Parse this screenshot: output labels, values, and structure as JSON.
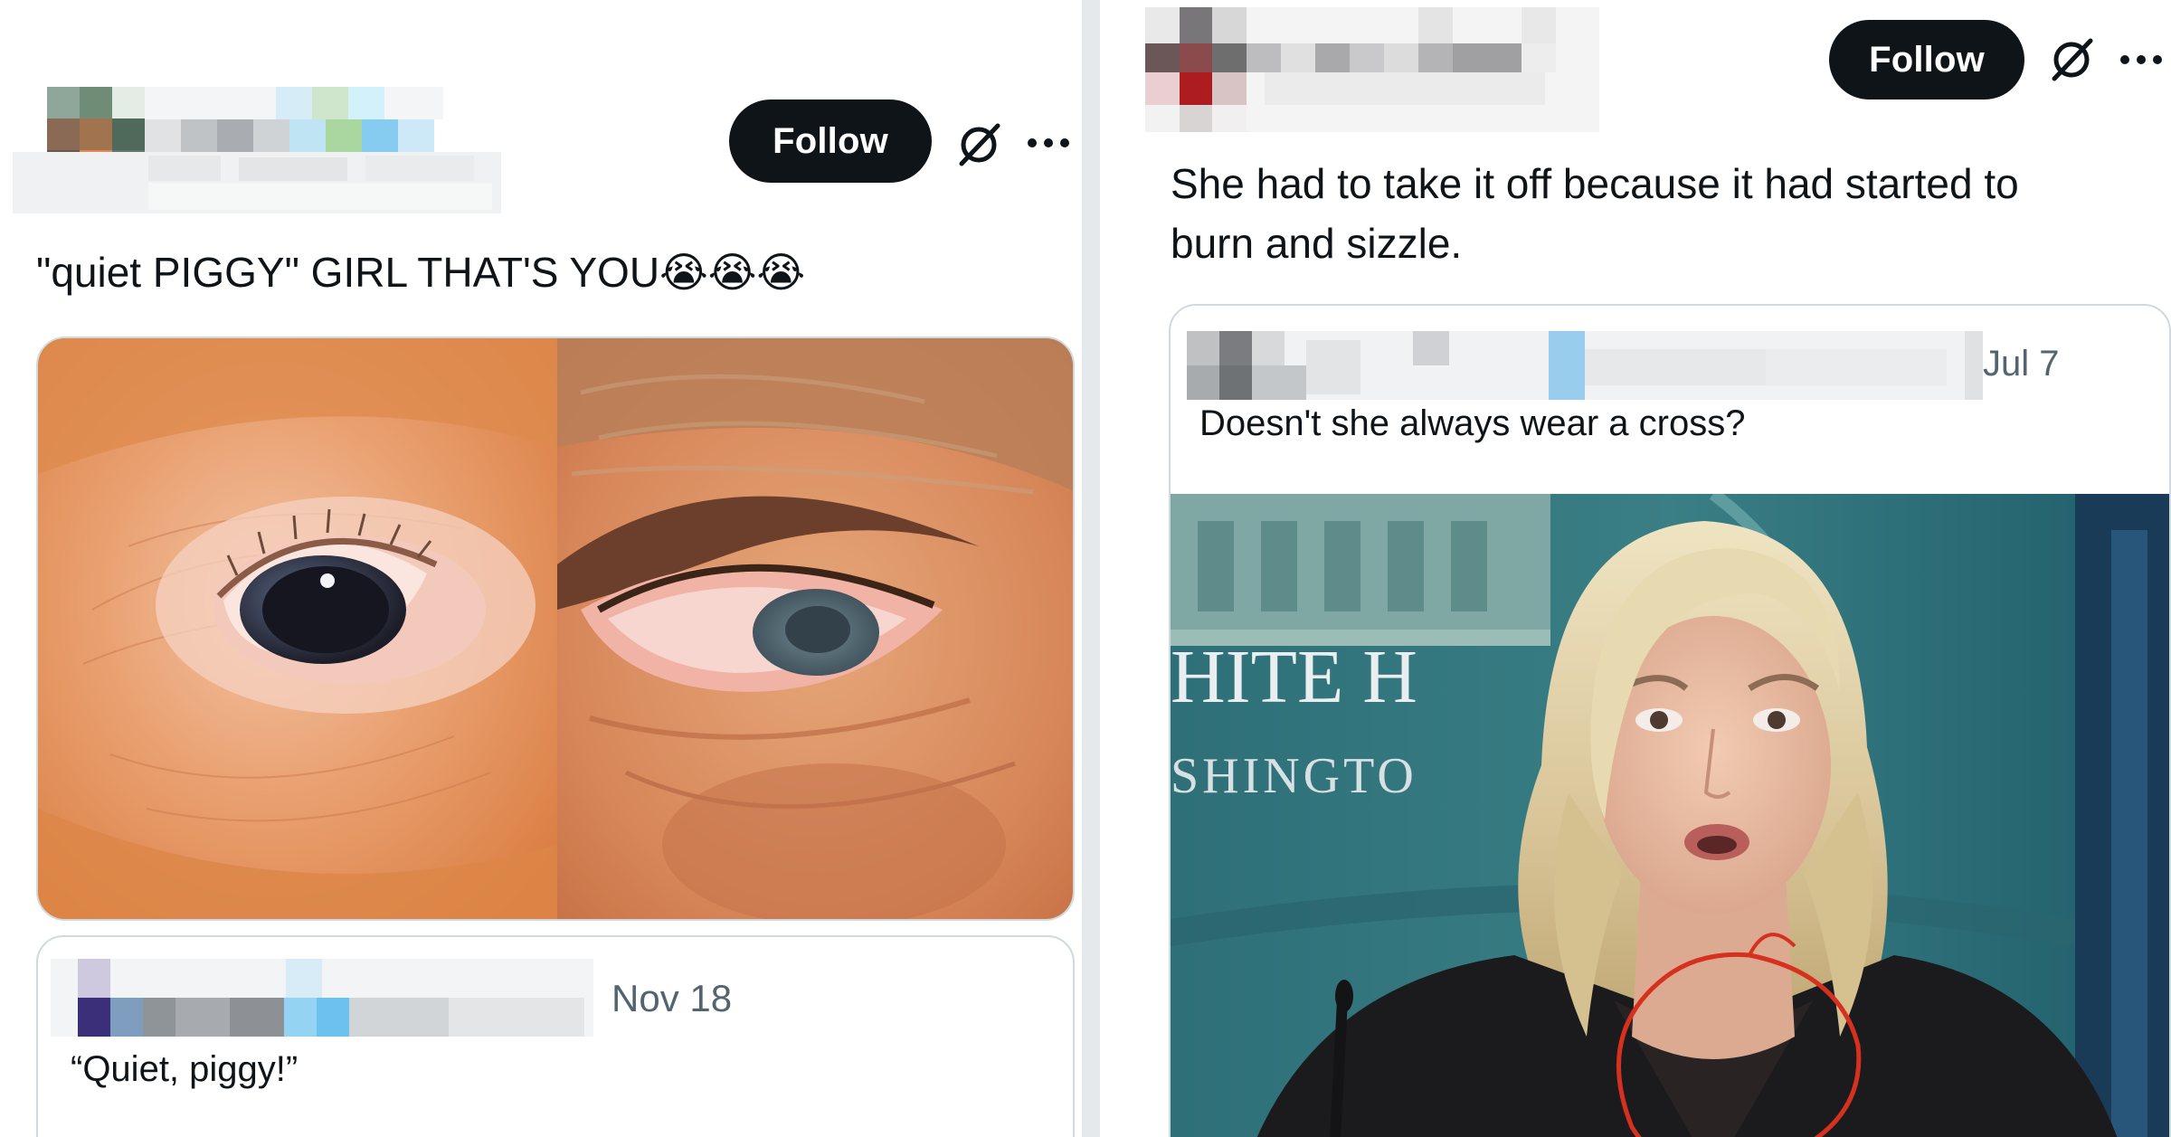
{
  "left_post": {
    "follow_label": "Follow",
    "text": "\"quiet PIGGY\" GIRL THAT'S YOU",
    "emoji": "😭😭😭",
    "icons": [
      "grok-icon",
      "more-options-icon"
    ],
    "quote": {
      "date": "Nov 18",
      "text": "“Quiet, piggy!”"
    }
  },
  "right_post": {
    "follow_label": "Follow",
    "text_line1": "She had to take it off because it had started to",
    "text_line2": "burn and sizzle.",
    "icons": [
      "grok-icon",
      "more-options-icon"
    ],
    "quote": {
      "date": "Jul 7",
      "text": "Doesn't she always wear a cross?",
      "image_sign_line1": "HITE H",
      "image_sign_line2": "SHINGTO"
    }
  },
  "colors": {
    "button_bg": "#0f1419",
    "button_text": "#ffffff",
    "secondary_text": "#536471",
    "border": "#cfd9de",
    "annotation_circle": "#d6301f"
  }
}
